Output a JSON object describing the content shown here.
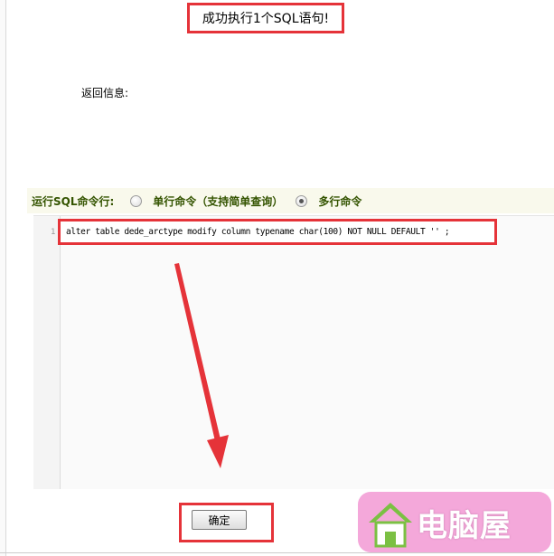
{
  "result": {
    "message": "成功执行1个SQL语句!"
  },
  "output": {
    "label": "返回信息:"
  },
  "command_bar": {
    "label": "运行SQL命令行:",
    "options": [
      {
        "label": "单行命令（支持简单查询）",
        "selected": false
      },
      {
        "label": "多行命令",
        "selected": true
      }
    ]
  },
  "editor": {
    "line_numbers": [
      "1"
    ],
    "code": "alter table dede_arctype modify column typename char(100) NOT NULL DEFAULT '' ;"
  },
  "submit": {
    "label": "确定"
  },
  "watermark": {
    "text": "电脑屋",
    "icon": "house-icon"
  },
  "colors": {
    "highlight_border": "#e53339",
    "arrow": "#e53339",
    "command_bar_text": "#345400",
    "watermark_bg": "#f4a8da"
  }
}
